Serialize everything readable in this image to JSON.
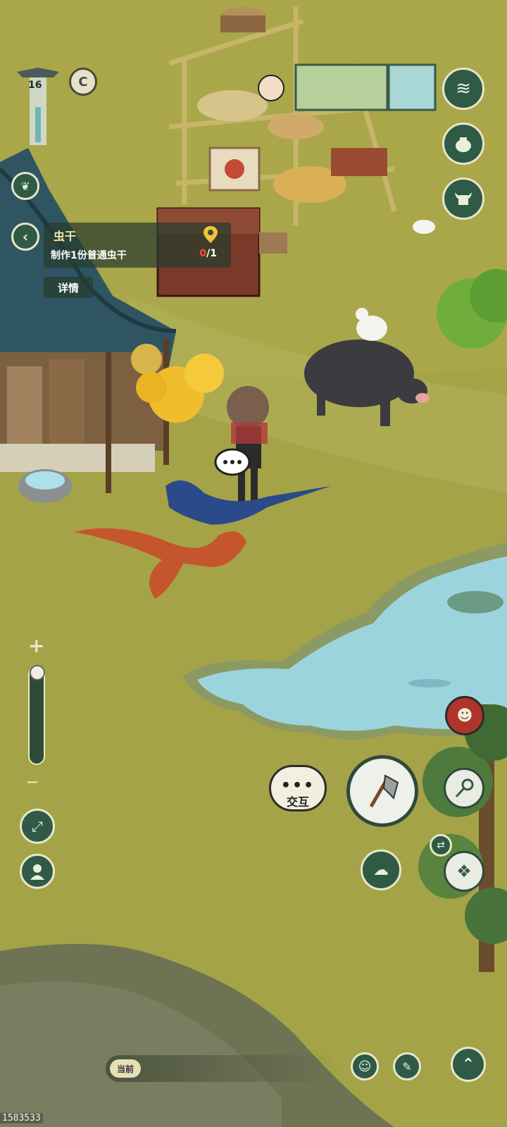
{
  "hud": {
    "level": "16",
    "quest": {
      "title": "虫干",
      "description": "制作1份普通虫干",
      "progress_current": "0",
      "progress_total": "/1"
    },
    "details_label": "详情",
    "interact_label": "交互",
    "chat_tag": "当前",
    "uid": "1583533",
    "zoom_plus": "+",
    "zoom_minus": "—"
  },
  "icons": {
    "collapse": "chevron-left-icon",
    "map_marker": "location-pin-icon",
    "wind_skill": "wave-icon",
    "pot": "pot-icon",
    "ox": "ox-icon",
    "axe": "axe-icon",
    "net": "net-icon",
    "cloud": "cloud-icon",
    "compass": "compass-icon",
    "swap": "swap-icon",
    "expand": "expand-icon",
    "character": "character-icon",
    "emoji": "smile-icon",
    "edit": "pen-icon",
    "up": "chevron-up-icon"
  },
  "colors": {
    "hud_green": "#2f5a45",
    "hud_border": "#e8e6c9",
    "quest_title": "#f4e6a6",
    "progress_red": "#ff4a3a",
    "grass": "#a9a74a",
    "water": "#9cd4dd"
  }
}
